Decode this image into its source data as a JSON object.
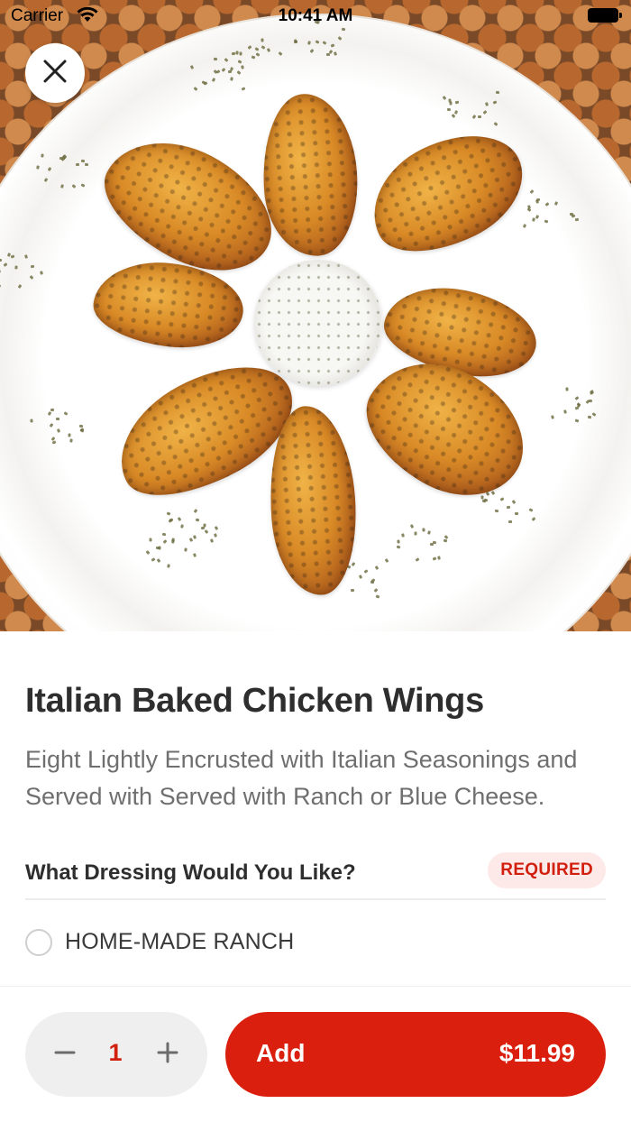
{
  "status_bar": {
    "carrier": "Carrier",
    "time": "10:41 AM"
  },
  "hero": {
    "image": "plate-of-italian-baked-chicken-wings-with-ranch-cup",
    "close_icon": "close-icon"
  },
  "item": {
    "title": "Italian Baked Chicken Wings",
    "description": "Eight Lightly Encrusted with Italian Seasonings and Served with Served with Ranch or Blue Cheese."
  },
  "options_section": {
    "title": "What Dressing Would You Like?",
    "badge": "REQUIRED",
    "options": [
      {
        "label": "HOME-MADE RANCH",
        "selected": false
      }
    ]
  },
  "footer": {
    "quantity": "1",
    "minus_icon": "minus-icon",
    "plus_icon": "plus-icon",
    "add_label": "Add",
    "price": "$11.99"
  },
  "colors": {
    "accent": "#da1f0e",
    "badge_bg": "#fde9e8",
    "text_primary": "#2e2e2e",
    "text_secondary": "#6f6f6f",
    "stepper_bg": "#efefef"
  }
}
